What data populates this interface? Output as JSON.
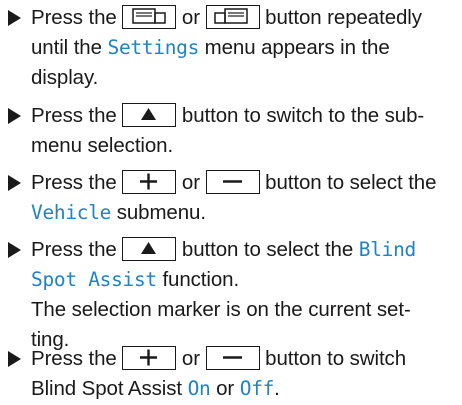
{
  "steps": [
    {
      "s1": "Press the",
      "or": "or",
      "s2": "button repeatedly",
      "s3": "until the",
      "menu": "Settings",
      "s4": "menu appears in the",
      "s5": "display."
    },
    {
      "s1": "Press the",
      "s2": "button to switch to the sub-",
      "s3": "menu selection."
    },
    {
      "s1": "Press the",
      "or": "or",
      "s2": "button to select the",
      "menu": "Vehicle",
      "s3": "submenu."
    },
    {
      "s1": "Press the",
      "s2": "button to select the",
      "fn_a": "Blind",
      "fn_b": "Spot Assist",
      "s3": "function.",
      "s4": "The selection marker is on the current set-",
      "s5": "ting."
    },
    {
      "s1": "Press the",
      "or": "or",
      "s2": "button to switch",
      "s3": "Blind Spot Assist",
      "on": "On",
      "or2": "or",
      "off": "Off",
      "end": "."
    }
  ],
  "colors": {
    "display_text": "#1f83c4",
    "body_text": "#1a1a1a"
  },
  "icons": [
    "bullet-arrow-icon",
    "page-back-icon",
    "page-forward-icon",
    "up-arrow-icon",
    "plus-icon",
    "minus-icon"
  ]
}
